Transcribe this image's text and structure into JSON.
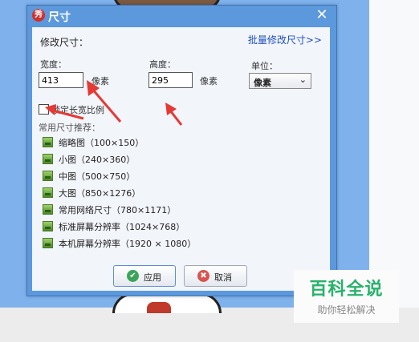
{
  "dialog": {
    "title": "尺寸",
    "app_icon": "秀",
    "close_symbol": "✕",
    "heading": "修改尺寸：",
    "batch_link": "批量修改尺寸>>"
  },
  "width": {
    "label": "宽度：",
    "value": "413",
    "unit": "像素"
  },
  "height": {
    "label": "高度：",
    "value": "295",
    "unit": "像素"
  },
  "unit_select": {
    "label": "单位：",
    "selected": "像素"
  },
  "lock_ratio": {
    "label": "锁定长宽比例",
    "checked": false
  },
  "presets": {
    "title": "常用尺寸推荐：",
    "items": [
      {
        "label": "缩略图（100×150）"
      },
      {
        "label": "小图（240×360）"
      },
      {
        "label": "中图（500×750）"
      },
      {
        "label": "大图（850×1276）"
      },
      {
        "label": "常用网络尺寸（780×1171）"
      },
      {
        "label": "标准屏幕分辨率（1024×768）"
      },
      {
        "label": "本机屏幕分辨率（1920 × 1080）"
      }
    ]
  },
  "buttons": {
    "apply": {
      "label": "应用",
      "icon": "check-icon"
    },
    "cancel": {
      "label": "取消",
      "icon": "cancel-icon"
    }
  },
  "watermark": {
    "main": "百科全说",
    "sub": "助你轻松解决"
  },
  "colors": {
    "dialog_blue": "#5c98dc",
    "link_blue": "#1f4fbf",
    "arrow_red": "#e53935",
    "watermark_green": "#27b26a"
  }
}
